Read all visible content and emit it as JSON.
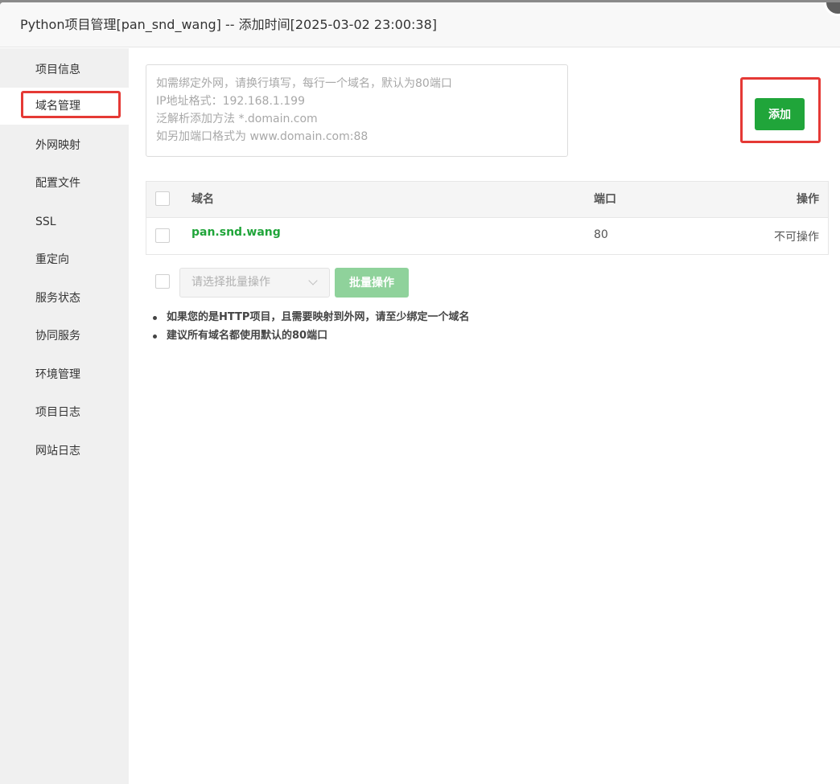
{
  "window": {
    "title": "Python项目管理[pan_snd_wang] -- 添加时间[2025-03-02 23:00:38]"
  },
  "sidebar": {
    "items": [
      {
        "label": "项目信息"
      },
      {
        "label": "域名管理",
        "active": true
      },
      {
        "label": "外网映射"
      },
      {
        "label": "配置文件"
      },
      {
        "label": "SSL"
      },
      {
        "label": "重定向"
      },
      {
        "label": "服务状态"
      },
      {
        "label": "协同服务"
      },
      {
        "label": "环境管理"
      },
      {
        "label": "项目日志"
      },
      {
        "label": "网站日志"
      }
    ]
  },
  "domain_form": {
    "placeholder": "如需绑定外网，请换行填写，每行一个域名，默认为80端口\nIP地址格式：192.168.1.199\n泛解析添加方法 *.domain.com\n如另加端口格式为 www.domain.com:88",
    "value": "",
    "add_label": "添加"
  },
  "table": {
    "headers": {
      "domain": "域名",
      "port": "端口",
      "action": "操作"
    },
    "rows": [
      {
        "domain": "pan.snd.wang",
        "port": "80",
        "action": "不可操作"
      }
    ]
  },
  "batch": {
    "select_placeholder": "请选择批量操作",
    "button_label": "批量操作"
  },
  "tips": [
    "如果您的是HTTP项目，且需要映射到外网，请至少绑定一个域名",
    "建议所有域名都使用默认的80端口"
  ],
  "colors": {
    "accent": "#20a53a",
    "highlight": "#e53935",
    "sidebar_bg": "#f0f0f0"
  }
}
